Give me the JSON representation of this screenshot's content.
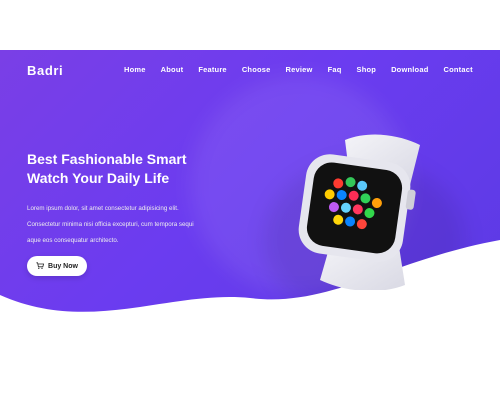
{
  "brand": {
    "name": "Badri"
  },
  "nav": {
    "items": [
      "Home",
      "About",
      "Feature",
      "Choose",
      "Review",
      "Faq",
      "Shop",
      "Download",
      "Contact"
    ]
  },
  "hero": {
    "headline_line1": "Best Fashionable Smart",
    "headline_line2": "Watch Your Daily Life",
    "desc_line1": "Lorem ipsum dolor, sit amet consectetur adipisicing elit.",
    "desc_line2": "Consectetur minima nisi officia excepturi, cum tempora sequi",
    "desc_line3": "aque eos consequatur architecto.",
    "cta_label": "Buy Now"
  },
  "colors": {
    "hero_start": "#7a3fe6",
    "hero_end": "#5a3ae3",
    "button_bg": "#ffffff"
  },
  "icons": {
    "cart": "cart-icon",
    "product": "smartwatch-image"
  }
}
